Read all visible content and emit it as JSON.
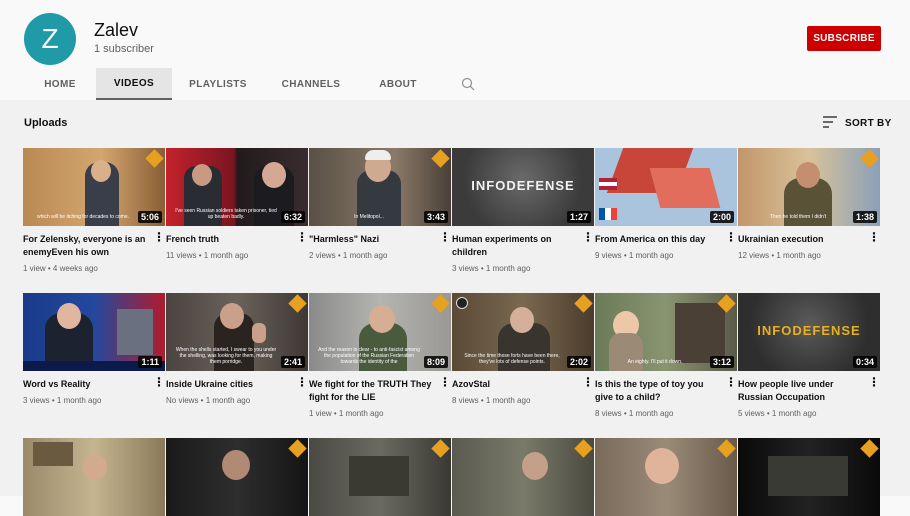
{
  "channel": {
    "avatar_letter": "Z",
    "name": "Zalev",
    "subscribers": "1 subscriber",
    "subscribe_label": "SUBSCRIBE"
  },
  "tabs": [
    {
      "label": "HOME"
    },
    {
      "label": "VIDEOS"
    },
    {
      "label": "PLAYLISTS"
    },
    {
      "label": "CHANNELS"
    },
    {
      "label": "ABOUT"
    }
  ],
  "section": {
    "title": "Uploads",
    "sort_label": "SORT BY"
  },
  "videos": [
    {
      "title": "For Zelensky, everyone is an enemyEven his own",
      "stats": "1 view • 4 weeks ago",
      "duration": "5:06",
      "caption": "which will be itching for decades to come."
    },
    {
      "title": "French truth",
      "stats": "11 views • 1 month ago",
      "duration": "6:32",
      "caption": "I've seen Russian soldiers taken prisoner, tied up beaten badly."
    },
    {
      "title": "\"Harmless\" Nazi",
      "stats": "2 views • 1 month ago",
      "duration": "3:43",
      "caption": "In Melitopol..."
    },
    {
      "title": "Human experiments on children",
      "stats": "3 views • 1 month ago",
      "duration": "1:27",
      "logo": "INFODEFENSE"
    },
    {
      "title": "From America on this day",
      "stats": "9 views • 1 month ago",
      "duration": "2:00"
    },
    {
      "title": "Ukrainian execution",
      "stats": "12 views • 1 month ago",
      "duration": "1:38",
      "caption": "Then he told them I didn't"
    },
    {
      "title": "Word vs Reality",
      "stats": "3 views • 1 month ago",
      "duration": "1:11"
    },
    {
      "title": "Inside Ukraine cities",
      "stats": "No views • 1 month ago",
      "duration": "2:41",
      "caption": "When the shells started, I swear to you under the shelling, was looking for them, making them porridge."
    },
    {
      "title": "We fight for the TRUTH They fight for the LIE",
      "stats": "1 view • 1 month ago",
      "duration": "8:09",
      "caption": "And the reason is clear - to anti-fascist among the population of the Russian Federation towards the identity of the"
    },
    {
      "title": "AzovStal",
      "stats": "8 views • 1 month ago",
      "duration": "2:02",
      "caption": "Since the time those forts have been there, they've lots of defense points."
    },
    {
      "title": "Is this the type of toy you give to a child?",
      "stats": "8 views • 1 month ago",
      "duration": "3:12",
      "caption": "An eighty. I'll put it down."
    },
    {
      "title": "How people live under Russian Occupation",
      "stats": "5 views • 1 month ago",
      "duration": "0:34",
      "logo": "INFODEFENSE"
    },
    {
      "title": "",
      "stats": "",
      "duration": ""
    },
    {
      "title": "",
      "stats": "",
      "duration": ""
    },
    {
      "title": "",
      "stats": "",
      "duration": ""
    },
    {
      "title": "",
      "stats": "",
      "duration": ""
    },
    {
      "title": "",
      "stats": "",
      "duration": ""
    },
    {
      "title": "",
      "stats": "",
      "duration": ""
    }
  ],
  "colors": {
    "subscribe": "#cc0000",
    "avatar": "#1f9aa6",
    "badge": "#e8a020"
  }
}
